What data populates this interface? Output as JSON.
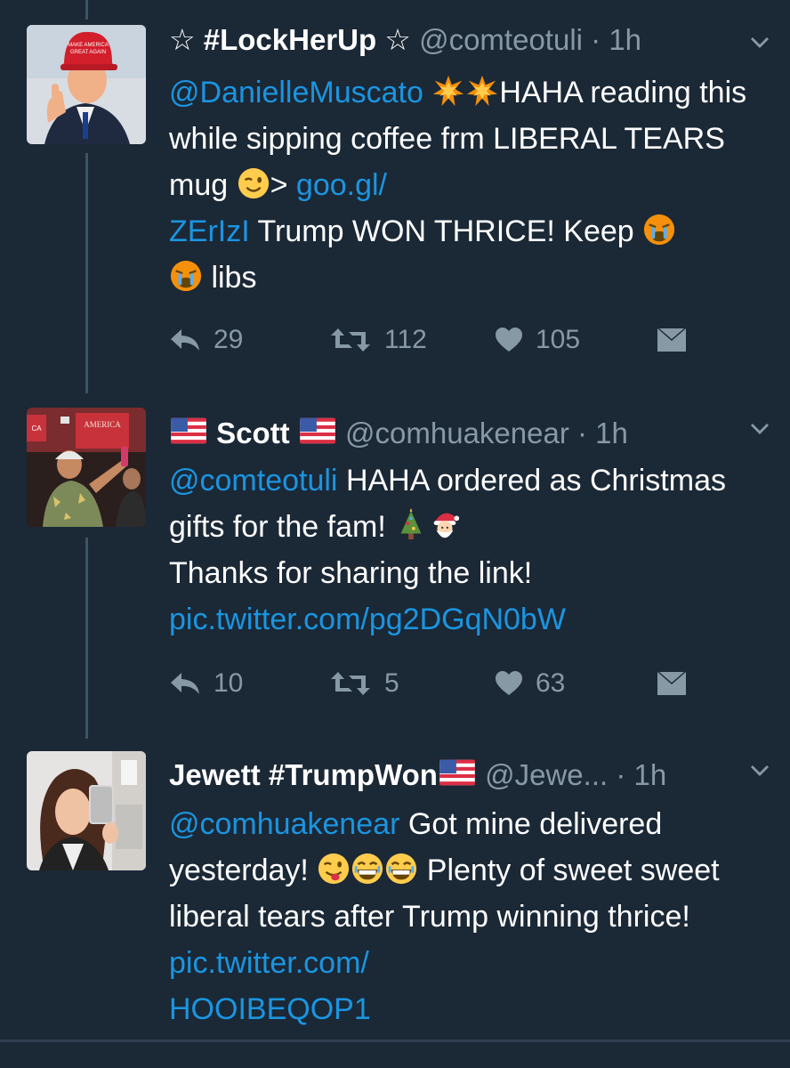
{
  "tweets": [
    {
      "display_name": "☆ #LockHerUp ☆",
      "handle": "@comteotuli",
      "time": "· 1h",
      "avatar": "trump-thumbs-up-photo",
      "text": {
        "mention": "@DanielleMuscato",
        "seg1": "HAHA reading this while sipping coffee frm LIBERAL TEARS mug",
        "seg2": ">",
        "link_a": "goo.gl/",
        "link_b": "ZErIzI",
        "seg3": "Trump WON THRICE! Keep",
        "seg4": "libs"
      },
      "emojis": [
        "collision-emoji",
        "collision-emoji",
        "wink-emoji",
        "crying-emoji",
        "crying-emoji"
      ],
      "replies": "29",
      "retweets": "112",
      "likes": "105"
    },
    {
      "display_name": "Scott",
      "handle": "@comhuakenear",
      "time": "· 1h",
      "avatar": "crowd-rally-photo",
      "text": {
        "mention": "@comteotuli",
        "seg1": "HAHA ordered as Christmas gifts for the fam!",
        "seg2": "Thanks for sharing the link!",
        "link": "pic.twitter.com/pg2DGqN0bW"
      },
      "emojis": [
        "us-flag-emoji",
        "us-flag-emoji",
        "christmas-tree-emoji",
        "santa-emoji"
      ],
      "replies": "10",
      "retweets": "5",
      "likes": "63"
    },
    {
      "display_name": "Jewett #TrumpWon",
      "handle": "@Jewe...",
      "time": "· 1h",
      "avatar": "selfie-photo",
      "text": {
        "mention": "@comhuakenear",
        "seg1": "Got mine delivered yesterday!",
        "seg2": "Plenty of sweet sweet liberal tears after Trump winning thrice!",
        "link_a": "pic.twitter.com/",
        "link_b": "HOOIBEQOP1"
      },
      "emojis": [
        "us-flag-emoji",
        "tongue-wink-emoji",
        "grin-emoji",
        "grin-emoji"
      ]
    }
  ],
  "colors": {
    "background": "#1b2836",
    "link": "#1b95e0",
    "secondary": "#8899a6",
    "thread": "#3d5466"
  },
  "icons": [
    "reply-icon",
    "retweet-icon",
    "like-icon",
    "dm-icon",
    "chevron-down-icon"
  ]
}
